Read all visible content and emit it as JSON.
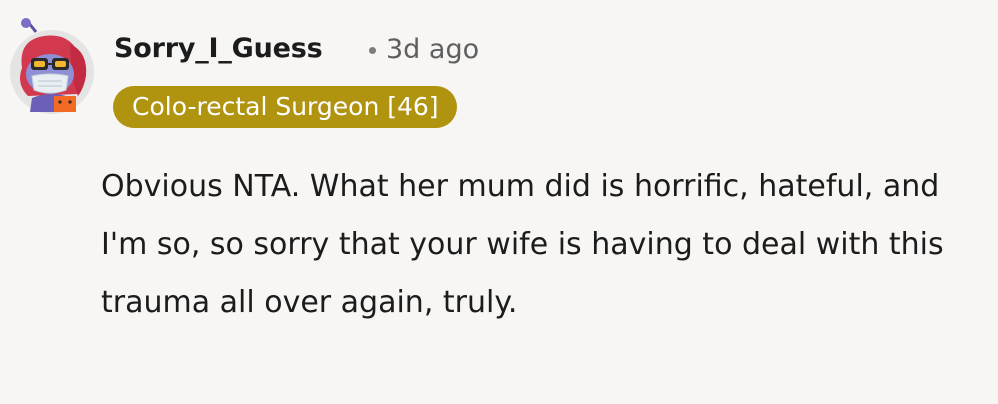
{
  "comment": {
    "author": "Sorry_I_Guess",
    "timestamp": "3d ago",
    "flair": "Colo-rectal Surgeon [46]",
    "body": "Obvious NTA. What her mum did is horrific, hateful, and I'm so, so sorry that your wife is having to deal with this trauma all over again, truly."
  },
  "avatar": {
    "icon": "snoo-avatar-icon"
  },
  "colors": {
    "flair_background": "#b0930e",
    "page_background": "#f7f6f4",
    "text": "#1c1c1c",
    "meta_text": "#5f5f5f"
  }
}
